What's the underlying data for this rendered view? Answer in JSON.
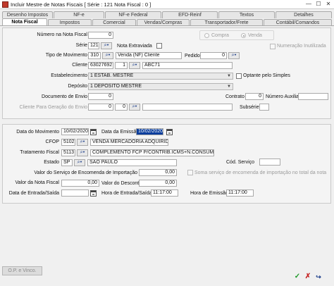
{
  "window": {
    "title": "Incluir Mestre de Notas Fiscais [ Série : 121 Nota Fiscal : 0 ]",
    "controls": {
      "minimize": "—",
      "maximize": "☐",
      "close": "✕"
    }
  },
  "tabs_top": [
    "Desenho Impostos",
    "NF-e",
    "NF-e Federal",
    "EFD-Reinf",
    "Textos",
    "Detalhes"
  ],
  "tabs_bottom": [
    "Nota Fiscal",
    "Impostos",
    "Comercial",
    "Vendas/Compras",
    "Transportador/Frete",
    "Contábil/Comandos"
  ],
  "active_tab": "Nota Fiscal",
  "section1": {
    "numero_label": "Número na Nota Fiscal",
    "numero_value": "0",
    "serie_label": "Série",
    "serie_value": "121",
    "extraviada_label": "Nota Extraviada",
    "compra_label": "Compra",
    "venda_label": "Venda",
    "numeracao_label": "Numeração Inutilizada",
    "tipo_label": "Tipo de Movimento",
    "tipo_code": "310",
    "tipo_desc": "Venda (NF) Cliente",
    "pedido_label": "Pedido",
    "pedido_value": "0",
    "cliente_label": "Cliente",
    "cliente_code": "63027692",
    "cliente_num": "1",
    "cliente_name": "ABC71",
    "estab_label": "Estabelecimento",
    "estab_value": "1 ESTAB. MESTRE",
    "optante_label": "Optante pelo Simples",
    "deposito_label": "Depósito",
    "deposito_value": "1 DEPÓSITO MESTRE",
    "docenvio_label": "Documento de Envio",
    "docenvio_value": "0",
    "contrato_label": "Contrato",
    "contrato_value": "0",
    "numaux_label": "Número Auxiliar",
    "clienteger_label": "Cliente Para Geração do Envio",
    "clienteger_code": "0",
    "clienteger_num": "0",
    "subserie_label": "Subsérie"
  },
  "section2": {
    "datamov_label": "Data do Movimento",
    "datamov_value": "10/02/2020",
    "dataemi_label": "Data da Emissão",
    "dataemi_value": "10/02/2020",
    "cfop_label": "CFOP",
    "cfop_code": "5102",
    "cfop_desc": "VENDA MERCADORIA ADQUIRIDA",
    "trat_label": "Tratamento Fiscal",
    "trat_code": "5113",
    "trat_desc": "COMPLEMENTO FCP P/CONTRIB.ICMS+N.CONSUM. FINAL",
    "estado_label": "Estado",
    "estado_code": "SP",
    "estado_desc": "SAO PAULO",
    "codserv_label": "Cód. Serviço",
    "valserv_label": "Valor do Serviço de Encomenda de Importação",
    "valserv_value": "0,00",
    "soma_label": "Soma serviço de encomenda de importação no total da nota",
    "valnota_label": "Valor da Nota Fiscal",
    "valnota_value": "0,00",
    "valdesc_label": "Valor do Desconto",
    "valdesc_value": "0,00",
    "dataent_label": "Data de Entrada/Saída",
    "horaent_label": "Hora de Entrada/Saída",
    "horaent_value": "11:17:00",
    "horaemi_label": "Hora de Emissão",
    "horaemi_value": "11:17:00"
  },
  "footer": {
    "ops_label": "O.P. e Vinco.",
    "ok_icon": "✓",
    "cancel_icon": "✗",
    "exit_icon": "↪"
  },
  "colors": {
    "selected": "#0a3d9c",
    "ok": "#1f9a2a",
    "cancel": "#c62828"
  }
}
